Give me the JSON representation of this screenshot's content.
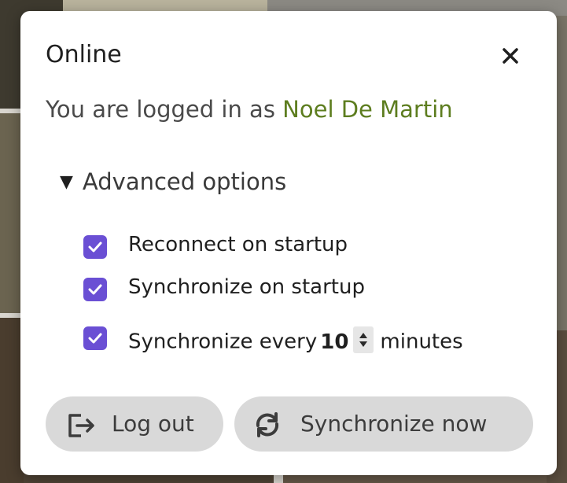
{
  "dialog": {
    "title": "Online",
    "close_icon": "close-icon",
    "status_prefix": "You are logged in as",
    "username": "Noel De Martin"
  },
  "advanced": {
    "label": "Advanced options",
    "expanded": true,
    "options": [
      {
        "label": "Reconnect on startup",
        "checked": true
      },
      {
        "label": "Synchronize on startup",
        "checked": true
      }
    ],
    "interval": {
      "prefix": "Synchronize every",
      "value": "10",
      "suffix": "minutes",
      "checked": true
    }
  },
  "actions": {
    "logout_label": "Log out",
    "logout_icon": "logout-icon",
    "sync_label": "Synchronize now",
    "sync_icon": "sync-icon"
  },
  "colors": {
    "accent": "#6a4fd4",
    "username": "#5d7d1f",
    "button_bg": "#d9d9d9"
  }
}
